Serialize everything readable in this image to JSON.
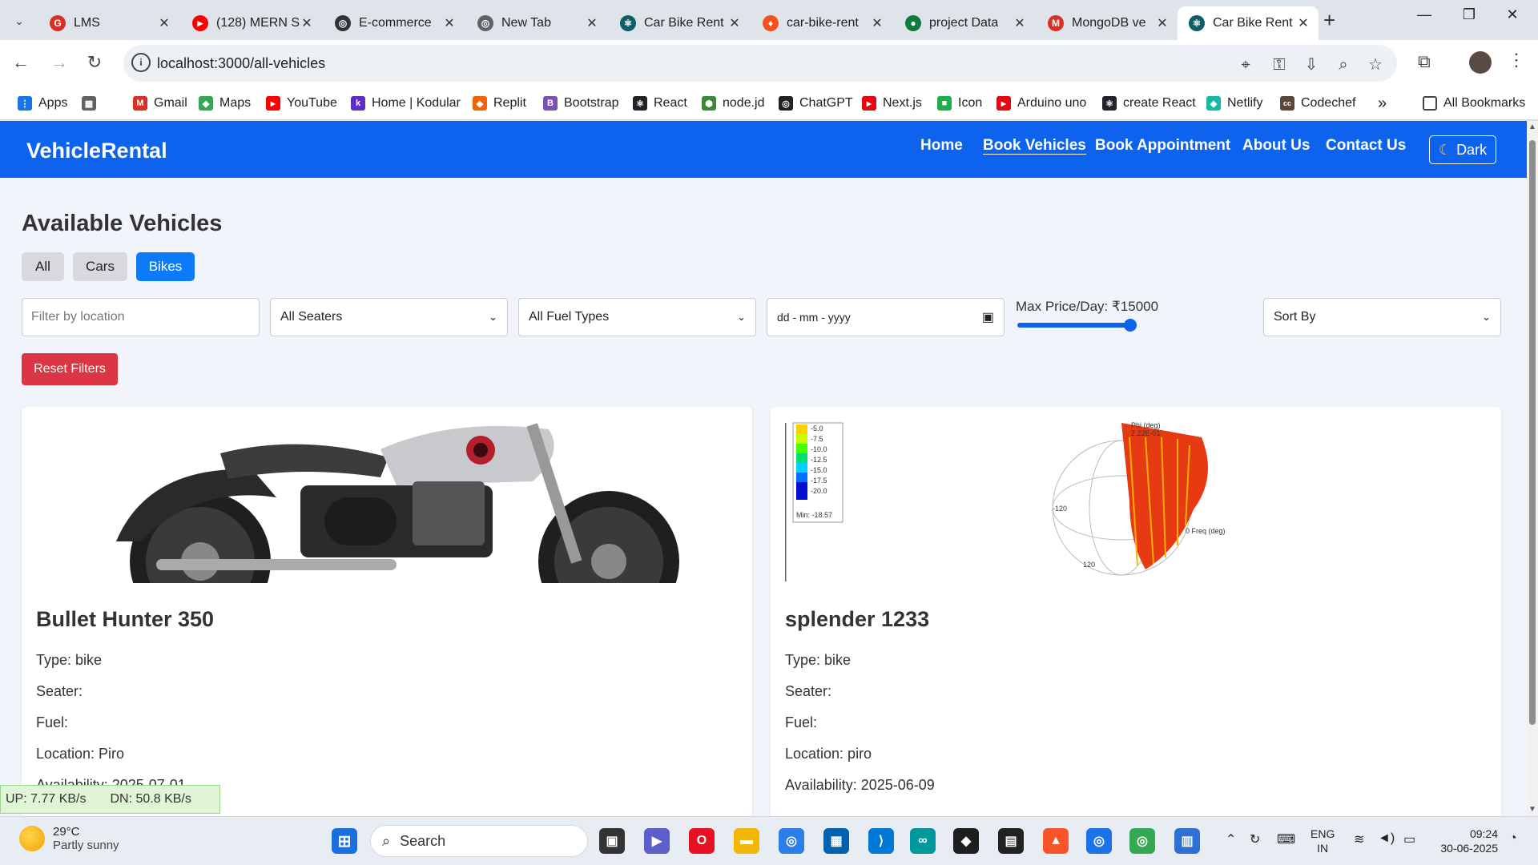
{
  "browser": {
    "tabs": [
      {
        "title": "LMS",
        "fav_color": "#d93025",
        "fav_glyph": "G"
      },
      {
        "title": "(128) MERN S",
        "fav_color": "#ff0000",
        "fav_glyph": "▶"
      },
      {
        "title": "E-commerce",
        "fav_color": "#333333",
        "fav_glyph": "◎"
      },
      {
        "title": "New Tab",
        "fav_color": "#5f6368",
        "fav_glyph": "◎"
      },
      {
        "title": "Car Bike Rent",
        "fav_color": "#0b5f66",
        "fav_glyph": "⚛"
      },
      {
        "title": "car-bike-rent",
        "fav_color": "#f4511e",
        "fav_glyph": "♦"
      },
      {
        "title": "project Data",
        "fav_color": "#0f7a3e",
        "fav_glyph": "●"
      },
      {
        "title": "MongoDB ve",
        "fav_color": "#d93025",
        "fav_glyph": "M"
      },
      {
        "title": "Car Bike Rent",
        "fav_color": "#0b5f66",
        "fav_glyph": "⚛"
      }
    ],
    "url": "localhost:3000/all-vehicles",
    "bookmarks": [
      {
        "label": "Apps",
        "color": "#1a73e8",
        "glyph": "⋮"
      },
      {
        "label": "",
        "color": "#5f6368",
        "glyph": "▦"
      },
      {
        "label": "Gmail",
        "color": "#d93025",
        "glyph": "M"
      },
      {
        "label": "Maps",
        "color": "#34a853",
        "glyph": "◆"
      },
      {
        "label": "YouTube",
        "color": "#ff0000",
        "glyph": "▶"
      },
      {
        "label": "Home | Kodular",
        "color": "#5b2ec6",
        "glyph": "k"
      },
      {
        "label": "Replit",
        "color": "#f26207",
        "glyph": "◆"
      },
      {
        "label": "Bootstrap",
        "color": "#7952b3",
        "glyph": "B"
      },
      {
        "label": "React",
        "color": "#20232a",
        "glyph": "⚛"
      },
      {
        "label": "node.jd",
        "color": "#3c873a",
        "glyph": "⬢"
      },
      {
        "label": "ChatGPT",
        "color": "#222222",
        "glyph": "◎"
      },
      {
        "label": "Next.js",
        "color": "#e50914",
        "glyph": "▶"
      },
      {
        "label": "Icon",
        "color": "#1fae4b",
        "glyph": "■"
      },
      {
        "label": "Arduino uno",
        "color": "#e50914",
        "glyph": "▶"
      },
      {
        "label": "create React",
        "color": "#20232a",
        "glyph": "⚛"
      },
      {
        "label": "Netlify",
        "color": "#14b8a6",
        "glyph": "◆"
      },
      {
        "label": "Codechef",
        "color": "#5b4638",
        "glyph": "cc"
      }
    ],
    "more_bookmarks": "»",
    "all_bookmarks": "All Bookmarks"
  },
  "app": {
    "brand": "VehicleRental",
    "nav": [
      "Home",
      "Book Vehicles",
      "Book Appointment",
      "About Us",
      "Contact Us"
    ],
    "active_nav": "Book Vehicles",
    "theme_toggle": "Dark"
  },
  "page": {
    "heading": "Available Vehicles",
    "filter_tabs": [
      "All",
      "Cars",
      "Bikes"
    ],
    "active_filter": "Bikes",
    "location_placeholder": "Filter by location",
    "seaters_select": "All Seaters",
    "fuel_select": "All Fuel Types",
    "date_placeholder": "dd - mm - yyyy",
    "price_label": "Max Price/Day: ₹15000",
    "price_slider_fraction": 0.95,
    "sort_select": "Sort By",
    "reset_button": "Reset Filters"
  },
  "vehicles": [
    {
      "name": "Bullet Hunter 350",
      "type": "Type: bike",
      "seater": "Seater:",
      "fuel": "Fuel:",
      "location": "Location: Piro",
      "availability": "Availability: 2025-07-01"
    },
    {
      "name": "splender 1233",
      "type": "Type: bike",
      "seater": "Seater:",
      "fuel": "Fuel:",
      "location": "Location: piro",
      "availability": "Availability: 2025-06-09",
      "image_texts": {
        "legend": [
          "-5.0",
          "-7.5",
          "-10.0",
          "-12.5",
          "-15.0",
          "-17.5",
          "-20.0"
        ],
        "min": "Min: -18.57",
        "top": "Phi (deg)",
        "top2": "2.22E-01",
        "left": "-120",
        "bottom": "120",
        "right": "0 Freq (deg)"
      }
    }
  ],
  "overlay": {
    "up": "UP: 7.77 KB/s",
    "down": "DN: 50.8 KB/s"
  },
  "taskbar": {
    "temp": "29°C",
    "weather": "Partly sunny",
    "search": "Search",
    "lang1": "ENG",
    "lang2": "IN",
    "time": "09:24",
    "date": "30-06-2025"
  }
}
